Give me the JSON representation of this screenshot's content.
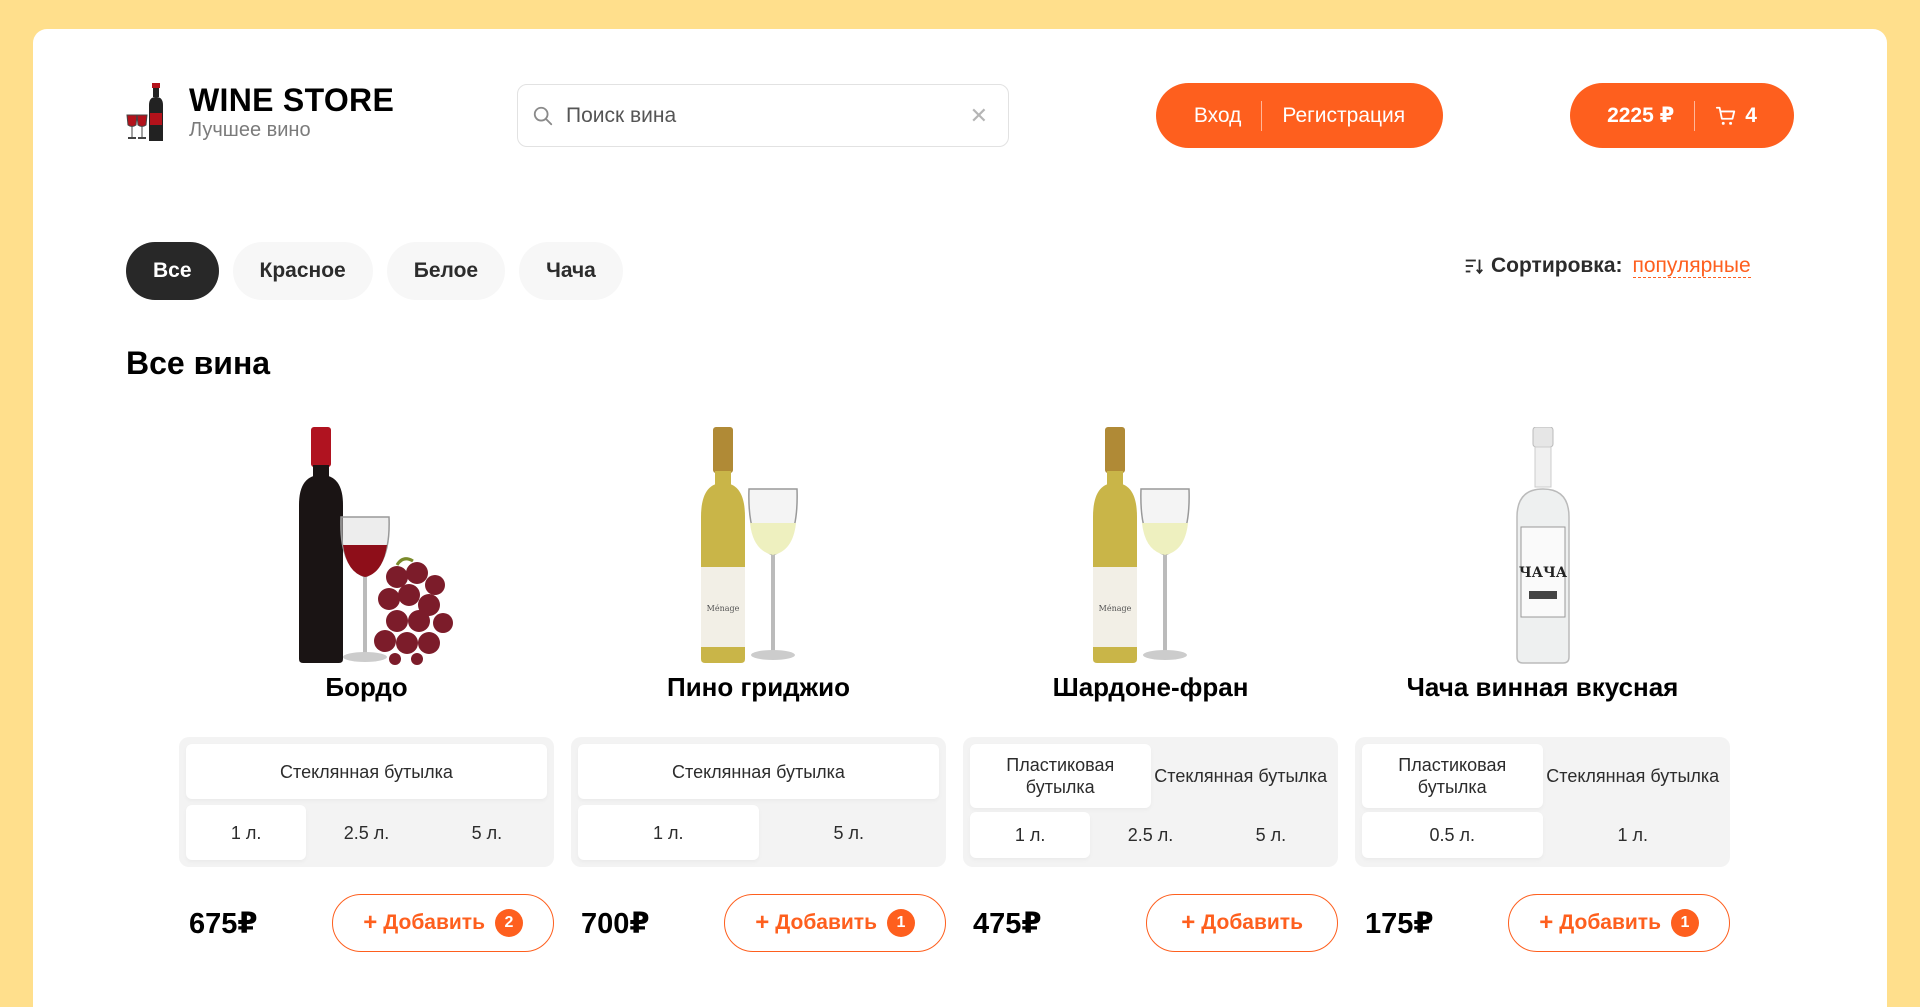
{
  "header": {
    "logo_title": "WINE STORE",
    "logo_subtitle": "Лучшее вино",
    "search_placeholder": "Поиск вина",
    "login_label": "Вход",
    "register_label": "Регистрация",
    "cart_total": "2225 ₽",
    "cart_count": "4"
  },
  "categories": [
    "Все",
    "Красное",
    "Белое",
    "Чача"
  ],
  "sort": {
    "label": "Сортировка:",
    "value": "популярные"
  },
  "section_title": "Все вина",
  "products": [
    {
      "name": "Бордо",
      "image_icon": "red-wine-with-grapes",
      "containers": [
        "Стеклянная бутылка"
      ],
      "volumes": [
        "1 л.",
        "2.5 л.",
        "5 л."
      ],
      "price": "675₽",
      "add_label": "Добавить",
      "count": "2"
    },
    {
      "name": "Пино гриджио",
      "image_icon": "white-wine-with-glass",
      "containers": [
        "Стеклянная бутылка"
      ],
      "volumes": [
        "1 л.",
        "5 л."
      ],
      "price": "700₽",
      "add_label": "Добавить",
      "count": "1"
    },
    {
      "name": "Шардоне-фран",
      "image_icon": "white-wine-with-glass",
      "containers": [
        "Пластиковая бутылка",
        "Стеклянная бутылка"
      ],
      "volumes": [
        "1 л.",
        "2.5 л.",
        "5 л."
      ],
      "price": "475₽",
      "add_label": "Добавить",
      "count": ""
    },
    {
      "name": "Чача винная вкусная",
      "image_icon": "chacha-bottle",
      "containers": [
        "Пластиковая бутылка",
        "Стеклянная бутылка"
      ],
      "volumes": [
        "0.5 л.",
        "1 л."
      ],
      "price": "175₽",
      "add_label": "Добавить",
      "count": "1"
    }
  ],
  "colors": {
    "accent": "#fe5f1e",
    "background": "#ffdf8c",
    "dark": "#282828"
  }
}
